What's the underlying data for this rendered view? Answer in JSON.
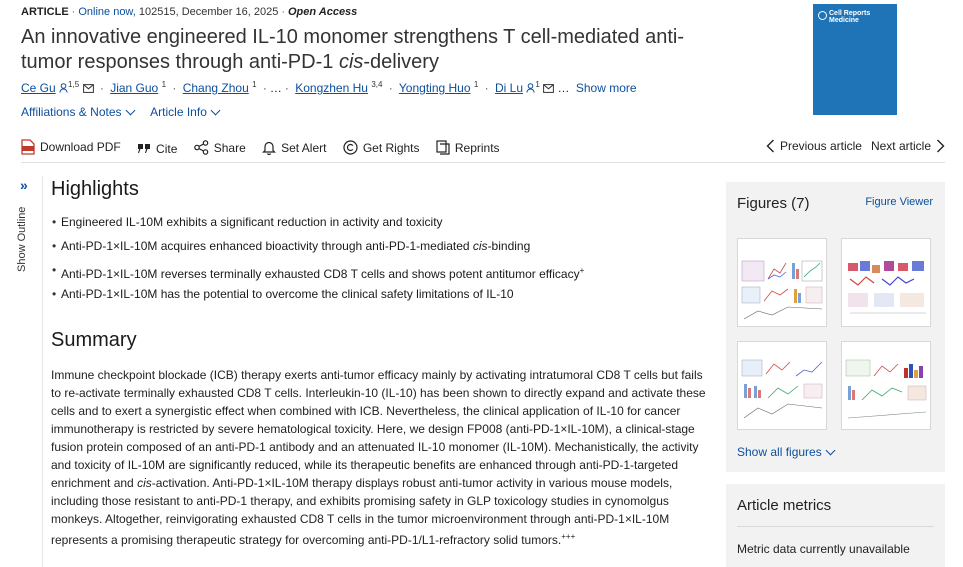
{
  "meta": {
    "type": "ARTICLE",
    "online": "Online now,",
    "details": "102515, December 16, 2025",
    "access": "Open Access"
  },
  "title": {
    "before": "An innovative engineered IL-10 monomer strengthens T cell-mediated anti-tumor responses through anti-PD-1 ",
    "italic": "cis",
    "after": "-delivery"
  },
  "authors": [
    {
      "name": "Ce Gu",
      "sup": "1,5",
      "person_icon": true,
      "email": true
    },
    {
      "name": "Jian Guo",
      "sup": "1"
    },
    {
      "name": "Chang Zhou",
      "sup": "1"
    },
    {
      "name": "Kongzhen Hu",
      "sup": "3,4"
    },
    {
      "name": "Yongting Huo",
      "sup": "1"
    },
    {
      "name": "Di Lu",
      "sup": "1",
      "person_icon": true,
      "email": true
    }
  ],
  "authors_ellipsis": "…",
  "show_more": "Show more",
  "subnav": {
    "affiliations": "Affiliations & Notes",
    "article_info": "Article Info"
  },
  "journal_cover": {
    "title_line1": "Cell Reports",
    "title_line2": "Medicine",
    "brand_color": "#1f73b7"
  },
  "toolbar": {
    "download_pdf": "Download PDF",
    "cite": "Cite",
    "share": "Share",
    "set_alert": "Set Alert",
    "get_rights": "Get Rights",
    "reprints": "Reprints",
    "previous": "Previous article",
    "next": "Next article",
    "pdf_color": "#c0392b"
  },
  "outline": {
    "label": "Show Outline"
  },
  "highlights": {
    "heading": "Highlights",
    "items": [
      {
        "before": "Engineered IL-10M exhibits a significant reduction in activity and toxicity",
        "italic": "",
        "after": ""
      },
      {
        "before": "Anti-PD-1×IL-10M acquires enhanced bioactivity through anti-PD-1-mediated ",
        "italic": "cis",
        "after": "-binding"
      },
      {
        "before": "Anti-PD-1×IL-10M reverses terminally exhausted CD8 T cells and shows potent antitumor efficacy",
        "italic": "",
        "after": "",
        "sup": "+"
      },
      {
        "before": "Anti-PD-1×IL-10M has the potential to overcome the clinical safety limitations of IL-10",
        "italic": "",
        "after": ""
      }
    ]
  },
  "summary": {
    "heading": "Summary",
    "part1": "Immune checkpoint blockade (ICB) therapy exerts anti-tumor efficacy mainly by activating intratumoral CD8 T cells but fails to re-activate terminally exhausted CD8 T cells. Interleukin-10 (IL-10) has been shown to directly expand and activate these cells and to exert a synergistic effect when combined with ICB. Nevertheless, the clinical application of IL-10 for cancer immunotherapy is restricted by severe hematological toxicity. Here, we design FP008 (anti-PD-1×IL-10M), a clinical-stage fusion protein composed of an anti-PD-1 antibody and an attenuated IL-10 monomer (IL-10M). Mechanistically, the activity and toxicity of IL-10M are significantly reduced, while its therapeutic benefits are enhanced through anti-PD-1-targeted enrichment and ",
    "italic": "cis",
    "part2": "-activation. Anti-PD-1×IL-10M therapy displays robust anti-tumor activity in various mouse models, including those resistant to anti-PD-1 therapy, and exhibits promising safety in GLP toxicology studies in cynomolgus monkeys. Altogether, reinvigorating exhausted CD8 T cells in the tumor microenvironment through anti-PD-1×IL-10M represents a promising therapeutic strategy for overcoming anti-PD-1/L1-refractory solid tumors.",
    "sup": "+++"
  },
  "figures": {
    "heading": "Figures (7)",
    "viewer": "Figure Viewer",
    "show_all": "Show all figures"
  },
  "metrics": {
    "heading": "Article metrics",
    "status": "Metric data currently unavailable"
  }
}
